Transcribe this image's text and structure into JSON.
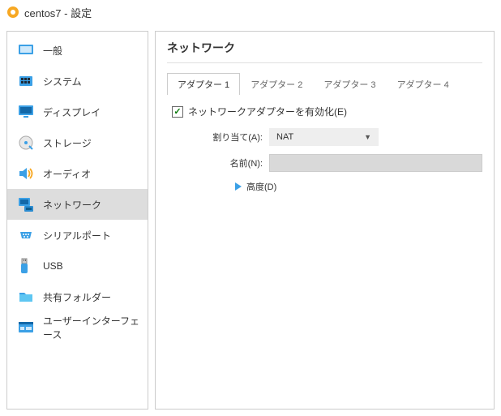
{
  "window": {
    "title": "centos7 - 設定"
  },
  "sidebar": {
    "items": [
      {
        "label": "一般"
      },
      {
        "label": "システム"
      },
      {
        "label": "ディスプレイ"
      },
      {
        "label": "ストレージ"
      },
      {
        "label": "オーディオ"
      },
      {
        "label": "ネットワーク"
      },
      {
        "label": "シリアルポート"
      },
      {
        "label": "USB"
      },
      {
        "label": "共有フォルダー"
      },
      {
        "label": "ユーザーインターフェース"
      }
    ]
  },
  "main": {
    "title": "ネットワーク",
    "tabs": [
      {
        "label": "アダプター 1"
      },
      {
        "label": "アダプター 2"
      },
      {
        "label": "アダプター 3"
      },
      {
        "label": "アダプター 4"
      }
    ],
    "enable_checkbox": {
      "label": "ネットワークアダプターを有効化(E)",
      "checked": true
    },
    "attached": {
      "label": "割り当て(A):",
      "value": "NAT"
    },
    "name": {
      "label": "名前(N):",
      "value": ""
    },
    "advanced": {
      "label": "高度(D)"
    }
  }
}
